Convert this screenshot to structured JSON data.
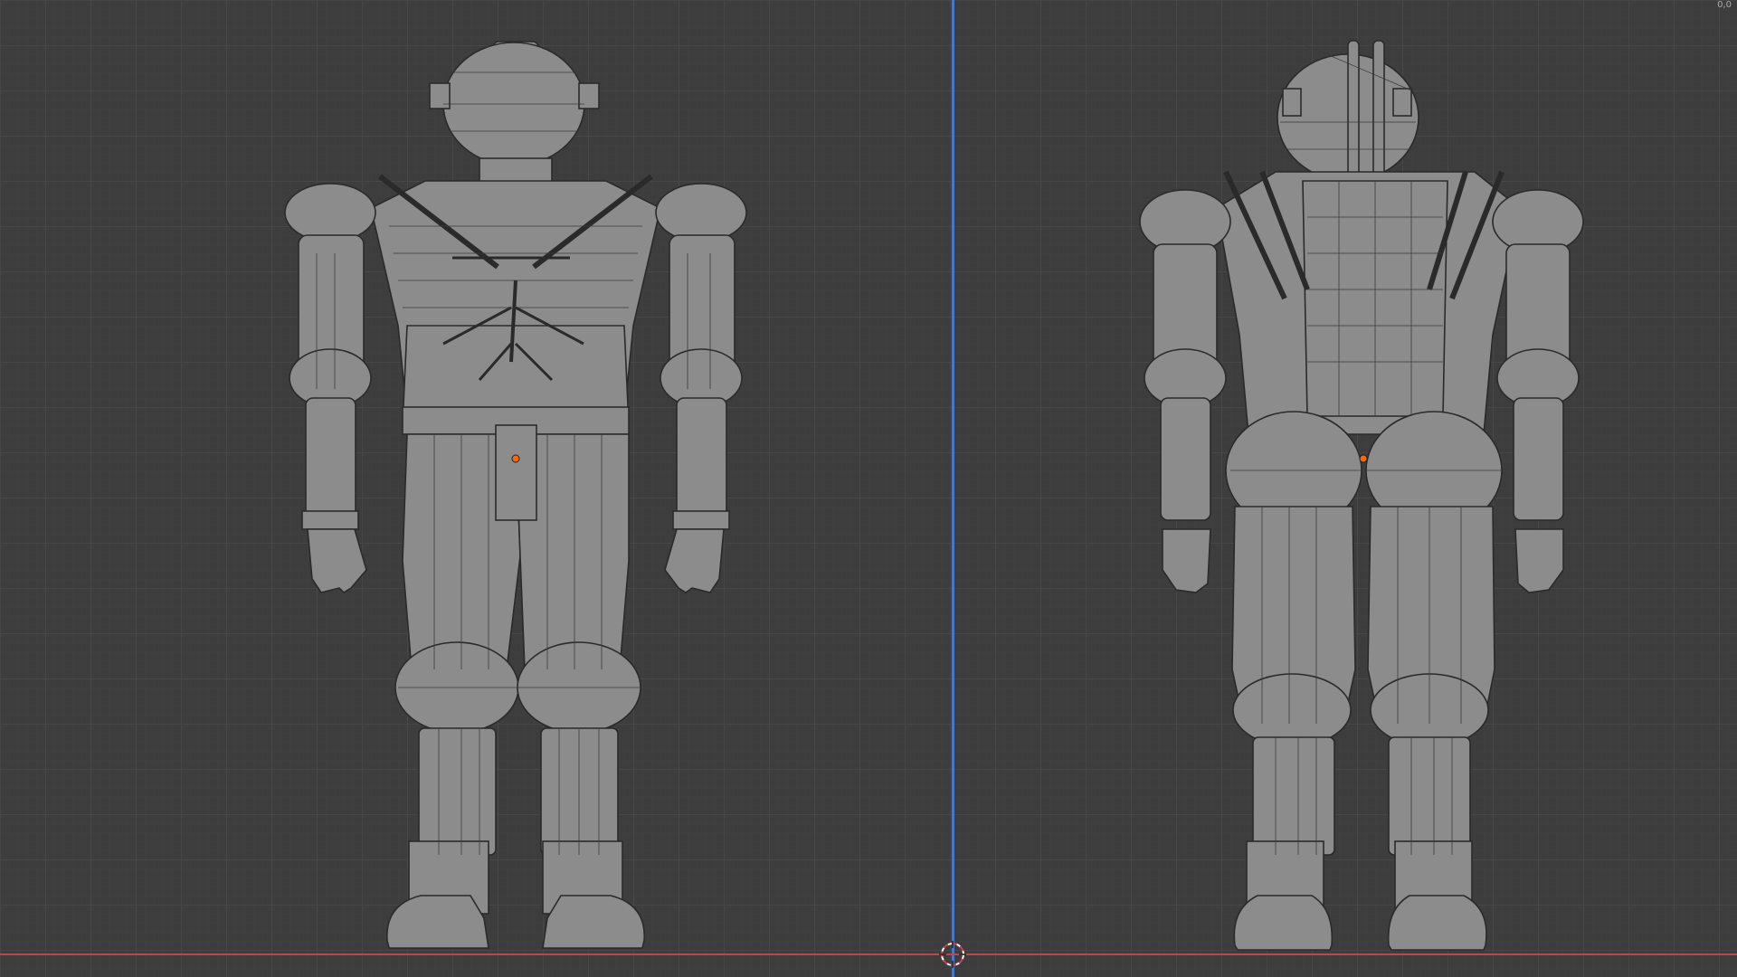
{
  "viewport": {
    "corner_text": "0,0",
    "grid": true,
    "axis_colors": {
      "z": "#4a78c8",
      "x": "#b84a4a"
    },
    "origin_color": "#ff6a00"
  },
  "models": [
    {
      "name": "robot-front-view"
    },
    {
      "name": "robot-back-view"
    }
  ],
  "icons": [
    "3d-cursor-icon",
    "object-origin-icon"
  ]
}
